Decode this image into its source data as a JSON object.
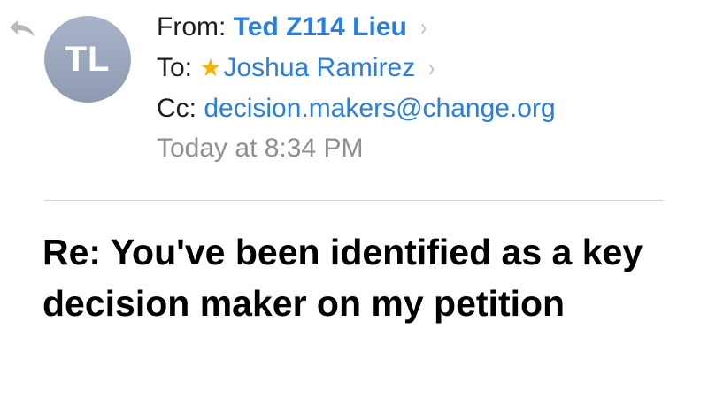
{
  "header": {
    "avatar_initials": "TL",
    "from_prefix": "From:",
    "from_name": "Ted Z114 Lieu",
    "to_prefix": "To:",
    "to_name": "Joshua Ramirez",
    "cc_prefix": "Cc:",
    "cc_address": "decision.makers@change.org",
    "date": "Today at 8:34 PM",
    "chevron": "›",
    "star": "★"
  },
  "subject": {
    "text": "Re: You've been identified as a key decision maker on my petition"
  },
  "icons": {
    "reply": "reply-arrow-icon",
    "chevron": "chevron-right-icon",
    "star": "star-icon"
  },
  "colors": {
    "link_blue": "#2a7de1",
    "star_gold": "#f4b400",
    "avatar_gray": "#9ca6bd",
    "secondary_gray": "#8e8e93"
  }
}
